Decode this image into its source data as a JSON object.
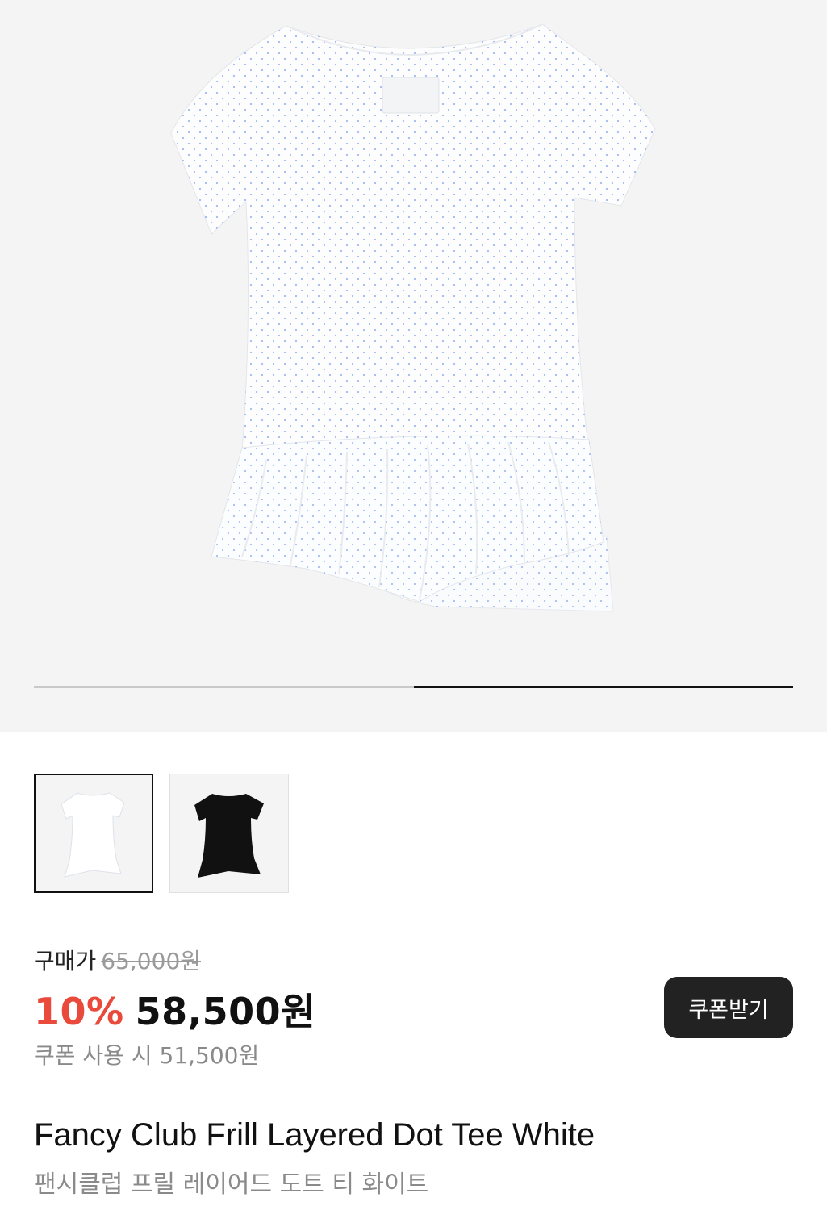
{
  "gallery": {
    "current_slide": 2,
    "total_slides": 2,
    "product_color": "#ffffff",
    "dot_color": "#5b8de8"
  },
  "thumbnails": [
    {
      "name": "white tee",
      "color": "#ffffff",
      "selected": true
    },
    {
      "name": "black tee",
      "color": "#111111",
      "selected": false
    }
  ],
  "pricing": {
    "label": "구매가",
    "original_price": "65,000원",
    "discount_rate": "10%",
    "sale_price": "58,500원",
    "coupon_price_text": "쿠폰 사용 시 51,500원",
    "coupon_button_label": "쿠폰받기",
    "discount_color": "#ea4a3c"
  },
  "product": {
    "name_en": "Fancy Club Frill Layered Dot Tee White",
    "name_ko": "팬시클럽 프릴 레이어드 도트 티 화이트"
  }
}
